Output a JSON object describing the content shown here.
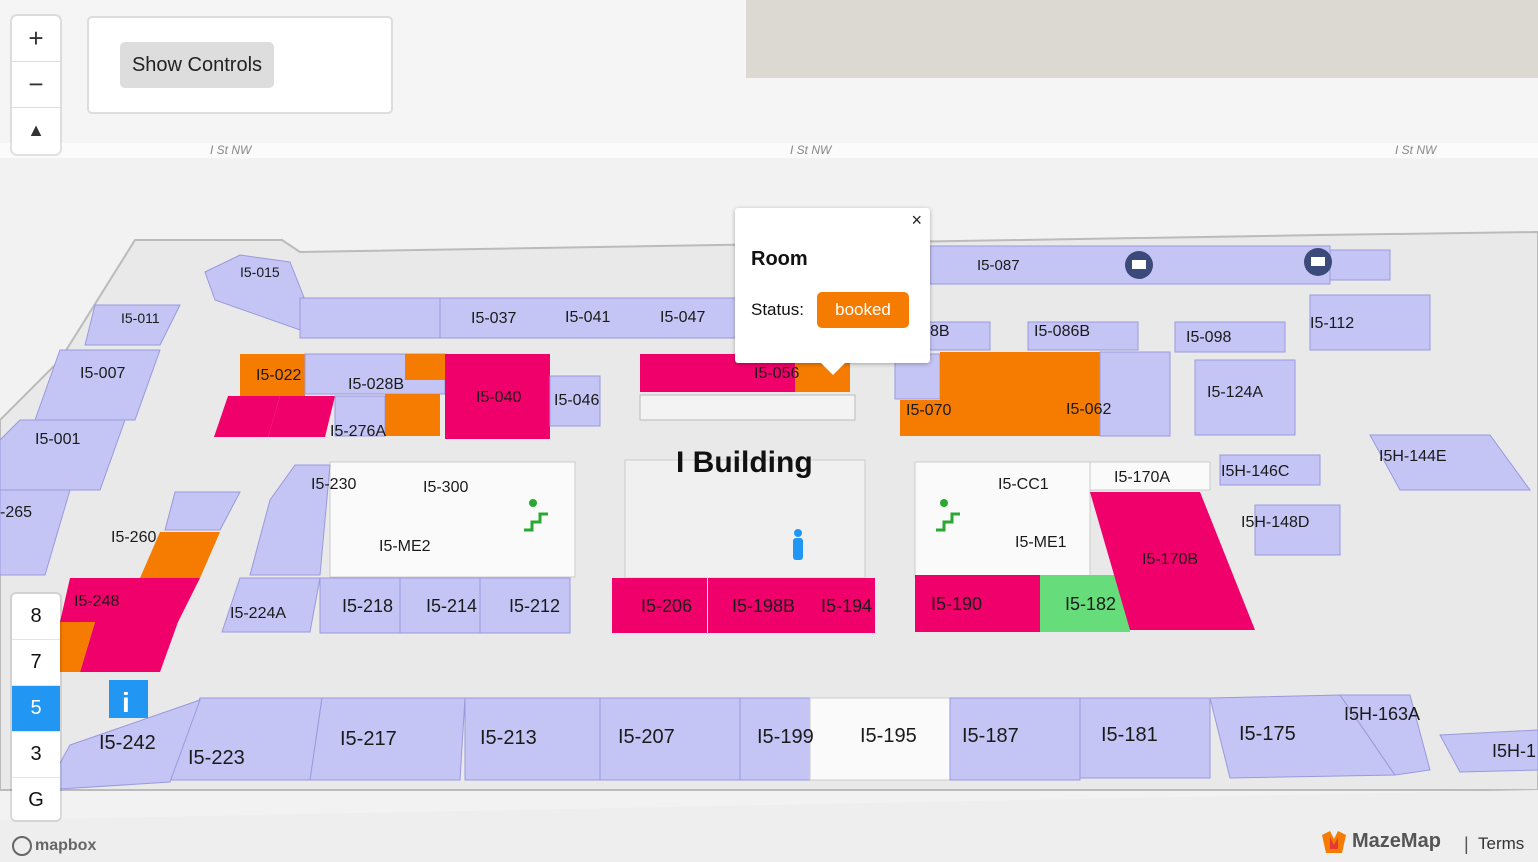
{
  "map": {
    "streets": [
      "I St NW",
      "I St NW",
      "I St NW"
    ],
    "building_label": "I Building",
    "rooms": {
      "r015": "I5-015",
      "r011": "I5-011",
      "r007": "I5-007",
      "r001": "I5-001",
      "r265": "-265",
      "r037": "I5-037",
      "r041": "I5-041",
      "r047": "I5-047",
      "r022": "I5-022",
      "r028b": "I5-028B",
      "r276a": "I5-276A",
      "r040": "I5-040",
      "r046": "I5-046",
      "r056": "I5-056",
      "r058b": "8B",
      "r086b": "I5-086B",
      "r087": "I5-087",
      "r098": "I5-098",
      "r112": "I5-112",
      "r070": "I5-070",
      "r062": "I5-062",
      "r124a": "I5-124A",
      "r230": "I5-230",
      "r300": "I5-300",
      "rme2": "I5-ME2",
      "rcc1": "I5-CC1",
      "r170a": "I5-170A",
      "rme1": "I5-ME1",
      "r170b": "I5-170B",
      "r146c": "I5H-146C",
      "r144e": "I5H-144E",
      "r148d": "I5H-148D",
      "r260": "I5-260",
      "r248": "I5-248",
      "r224a": "I5-224A",
      "r218": "I5-218",
      "r214": "I5-214",
      "r212": "I5-212",
      "r206": "I5-206",
      "r198b": "I5-198B",
      "r194": "I5-194",
      "r190": "I5-190",
      "r182": "I5-182",
      "r242": "I5-242",
      "r223": "I5-223",
      "r217": "I5-217",
      "r213": "I5-213",
      "r207": "I5-207",
      "r199": "I5-199",
      "r195": "I5-195",
      "r187": "I5-187",
      "r181": "I5-181",
      "r175": "I5-175",
      "r163a": "I5H-163A",
      "r1edge": "I5H-1"
    },
    "colors": {
      "available": "#c5c5f5",
      "booked": "#f57c00",
      "occupied": "#f0006a",
      "free": "#66dd7a",
      "neutral": "#ffffff",
      "corridor": "#e8e8e8"
    }
  },
  "controls": {
    "zoom_in": "+",
    "zoom_out": "−",
    "compass": "▲",
    "show_controls": "Show Controls"
  },
  "floors": [
    "8",
    "7",
    "5",
    "3",
    "G"
  ],
  "active_floor": "5",
  "popup": {
    "close": "×",
    "title": "Room",
    "status_label": "Status:",
    "status_value": "booked"
  },
  "attribution": {
    "mapbox": "mapbox",
    "mazemap": "MazeMap",
    "separator": "|",
    "terms": "Terms"
  }
}
